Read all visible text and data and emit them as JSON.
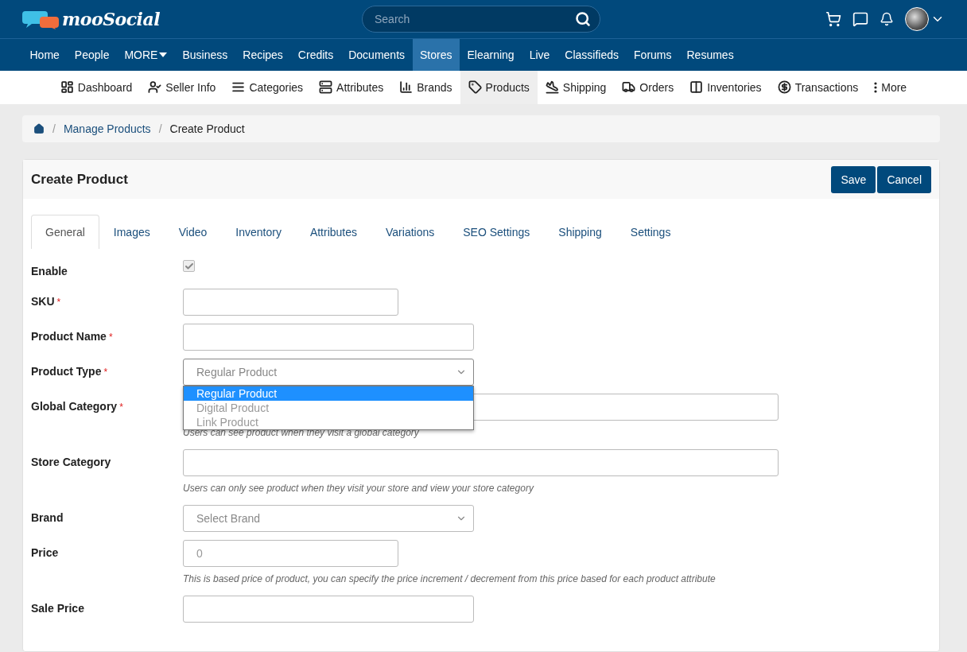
{
  "header": {
    "logo": "mooSocial",
    "search": {
      "placeholder": "Search"
    }
  },
  "main_nav": [
    {
      "label": "Home",
      "selected": false
    },
    {
      "label": "People",
      "selected": false
    },
    {
      "label": "MORE",
      "selected": false,
      "kind": "menu"
    },
    {
      "label": "Business",
      "selected": false
    },
    {
      "label": "Recipes",
      "selected": false
    },
    {
      "label": "Credits",
      "selected": false
    },
    {
      "label": "Documents",
      "selected": false
    },
    {
      "label": "Stores",
      "selected": true
    },
    {
      "label": "Elearning",
      "selected": false
    },
    {
      "label": "Live",
      "selected": false
    },
    {
      "label": "Classifieds",
      "selected": false
    },
    {
      "label": "Forums",
      "selected": false
    },
    {
      "label": "Resumes",
      "selected": false
    }
  ],
  "store_nav": [
    {
      "label": "Dashboard",
      "selected": false
    },
    {
      "label": "Seller Info",
      "selected": false
    },
    {
      "label": "Categories",
      "selected": false
    },
    {
      "label": "Attributes",
      "selected": false
    },
    {
      "label": "Brands",
      "selected": false
    },
    {
      "label": "Products",
      "selected": true
    },
    {
      "label": "Shipping",
      "selected": false
    },
    {
      "label": "Orders",
      "selected": false
    },
    {
      "label": "Inventories",
      "selected": false
    },
    {
      "label": "Transactions",
      "selected": false
    },
    {
      "label": "More",
      "selected": false
    }
  ],
  "breadcrumb": {
    "separator": "/",
    "items": [
      "Manage Products",
      "Create Product"
    ]
  },
  "card": {
    "title": "Create Product",
    "buttons": [
      "Save",
      "Cancel"
    ]
  },
  "tabs": [
    {
      "label": "General",
      "selected": true
    },
    {
      "label": "Images",
      "selected": false
    },
    {
      "label": "Video",
      "selected": false
    },
    {
      "label": "Inventory",
      "selected": false
    },
    {
      "label": "Attributes",
      "selected": false
    },
    {
      "label": "Variations",
      "selected": false
    },
    {
      "label": "SEO Settings",
      "selected": false
    },
    {
      "label": "Shipping",
      "selected": false
    },
    {
      "label": "Settings",
      "selected": false
    }
  ],
  "fields": [
    {
      "kind": "checkbox",
      "label": "Enable",
      "checked": true,
      "disabled": true
    },
    {
      "kind": "text",
      "label": "SKU",
      "required_mark": "*"
    },
    {
      "kind": "text",
      "label": "Product Name",
      "required_mark": "*"
    },
    {
      "kind": "select",
      "label": "Product Type",
      "required_mark": "*",
      "value": "Regular Product",
      "expanded": true,
      "options": [
        {
          "label": "Regular Product",
          "selected": true
        },
        {
          "label": "Digital Product",
          "selected": false
        },
        {
          "label": "Link Product",
          "selected": false
        }
      ]
    },
    {
      "kind": "text",
      "label": "Global Category",
      "required_mark": "*",
      "hint": "Users can see product when they visit a global category"
    },
    {
      "kind": "text",
      "label": "Store Category",
      "hint": "Users can only see product when they visit your store and view your store category"
    },
    {
      "kind": "select",
      "label": "Brand",
      "value": "Select Brand"
    },
    {
      "kind": "text",
      "label": "Price",
      "placeholder": "0",
      "hint": "This is based price of product, you can specify the price increment / decrement from this price based for each product attribute"
    },
    {
      "kind": "text",
      "label": "Sale Price"
    }
  ]
}
